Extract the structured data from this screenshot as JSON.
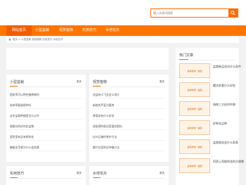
{
  "search": {
    "placeholder": "输入关键词搜索"
  },
  "nav": {
    "items": [
      "网站首页",
      "小型盆栽",
      "观赏植物",
      "实用技巧",
      "水培花卉"
    ]
  },
  "breadcrumb": "首页 > 小型盆栽 观赏植物 实用技巧 水培花卉",
  "panels": [
    {
      "title": "小型盆栽",
      "more": "更多",
      "items": [
        "国条草可以种些植养植吗",
        "软帝草要施肥种吗",
        "这冬盆栽种植是怎么过冬",
        "阁楼台的好的花盆物",
        "庭院里有没有晒的花",
        "触碰金苹果为什么会枯黄"
      ]
    },
    {
      "title": "观赏植物",
      "more": "更多",
      "items": [
        "花盆有小飞虫怎么消灭",
        "新栽的芦荟为黄养",
        "养菊花有什么好处",
        "老枇把的根还是喜欢肥料",
        "红叶石楠的养护方法",
        "紫竹在家附近种植方法"
      ]
    },
    {
      "title": "实用技巧",
      "more": "更多",
      "items": []
    },
    {
      "title": "水培花卉",
      "more": "更多",
      "items": []
    }
  ],
  "sidebar": {
    "title": "热门文章",
    "thumb_caption": "盆栽植物一盆图",
    "items": [
      "盆栽新品花向什么条件",
      "螺文虾要什么好吃",
      "海南三大经济作物",
      "好种花买种",
      "盆栽观花会什么条条",
      "阿娇上再根的花的方便哪"
    ]
  }
}
